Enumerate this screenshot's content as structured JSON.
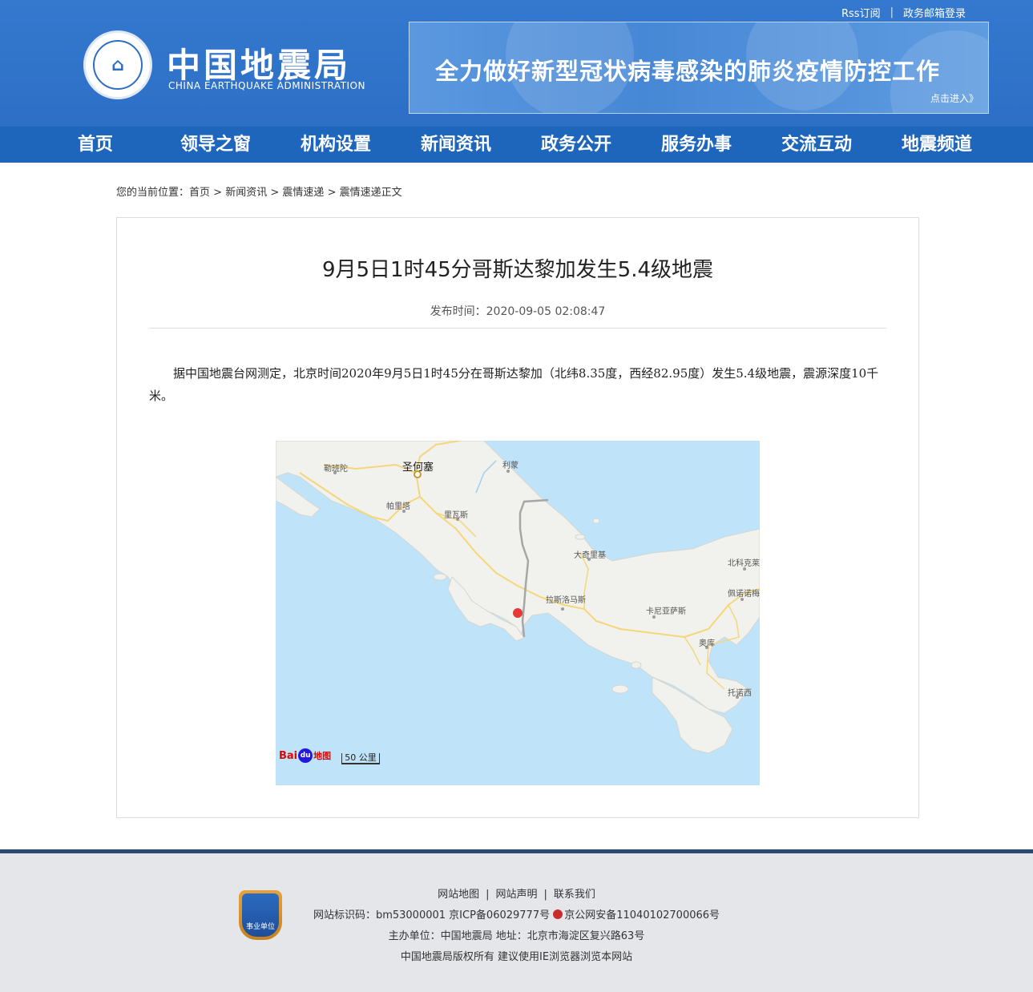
{
  "header": {
    "top_links": {
      "rss": "Rss订阅",
      "mail": "政务邮箱登录"
    },
    "site_name": "中国地震局",
    "site_name_en": "CHINA EARTHQUAKE ADMINISTRATION",
    "banner": {
      "title": "全力做好新型冠状病毒感染的肺炎疫情防控工作",
      "link": "点击进入》"
    }
  },
  "nav": [
    {
      "label": "首页"
    },
    {
      "label": "领导之窗"
    },
    {
      "label": "机构设置"
    },
    {
      "label": "新闻资讯"
    },
    {
      "label": "政务公开"
    },
    {
      "label": "服务办事"
    },
    {
      "label": "交流互动"
    },
    {
      "label": "地震频道"
    }
  ],
  "breadcrumb": {
    "prefix": "您的当前位置：",
    "items": [
      "首页",
      "新闻资讯",
      "震情速递",
      "震情速递正文"
    ],
    "sep": ">"
  },
  "article": {
    "title": "9月5日1时45分哥斯达黎加发生5.4级地震",
    "publish": "发布时间：2020-09-05 02:08:47",
    "body": "据中国地震台网测定，北京时间2020年9月5日1时45分在哥斯达黎加（北纬8.35度，西经82.95度）发生5.4级地震，震源深度10千米。"
  },
  "map": {
    "capital": "圣何塞",
    "places": [
      "勒班陀",
      "利蒙",
      "帕里塔",
      "里瓦斯",
      "大奇里基",
      "北科克莱",
      "佩诺诺梅",
      "拉斯洛马斯",
      "卡尼亚萨斯",
      "奥库",
      "托诺西"
    ],
    "brand": {
      "part1": "Bai",
      "paw": "du",
      "part2": "地图"
    },
    "scale": "50 公里",
    "colors": {
      "sea": "#bfe3f8",
      "land": "#f1f1ee",
      "road": "#f5d77a",
      "border": "#a6a6a6",
      "epicenter": "#e53935"
    }
  },
  "footer": {
    "links": [
      "网站地图",
      "网站声明",
      "联系我们"
    ],
    "badge": "事业单位",
    "row2": "网站标识码：bm53000001  京ICP备06029777号",
    "police": "京公网安备11040102700066号",
    "row3": "主办单位：中国地震局  地址：北京市海淀区复兴路63号",
    "row4": "中国地震局版权所有  建议使用IE浏览器浏览本网站"
  }
}
